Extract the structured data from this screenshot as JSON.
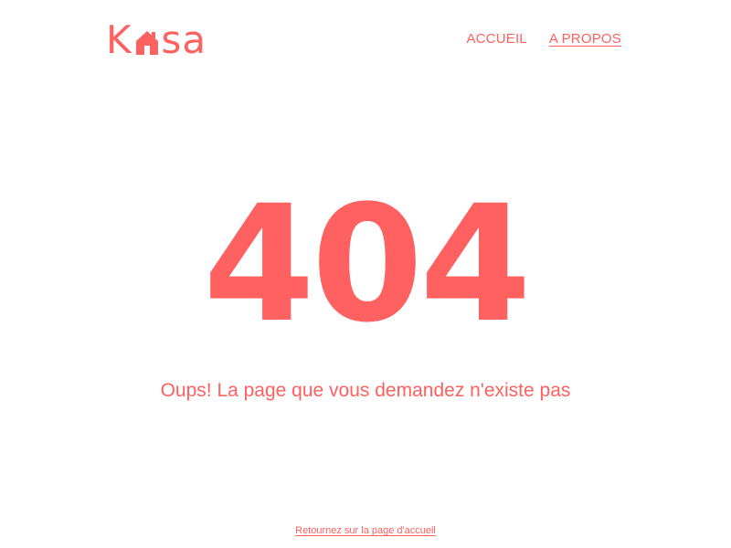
{
  "header": {
    "logo_left": "K",
    "logo_right": "sa",
    "nav": {
      "home_label": "ACCUEIL",
      "about_label": "A PROPOS"
    }
  },
  "main": {
    "error_code": "404",
    "message": "Oups! La page que vous demandez n'existe pas",
    "back_link_label": "Retournez sur la page d'accueil"
  },
  "colors": {
    "accent": "#FF6060",
    "background": "#FFFFFF"
  },
  "icons": {
    "logo_house": "house-icon"
  }
}
